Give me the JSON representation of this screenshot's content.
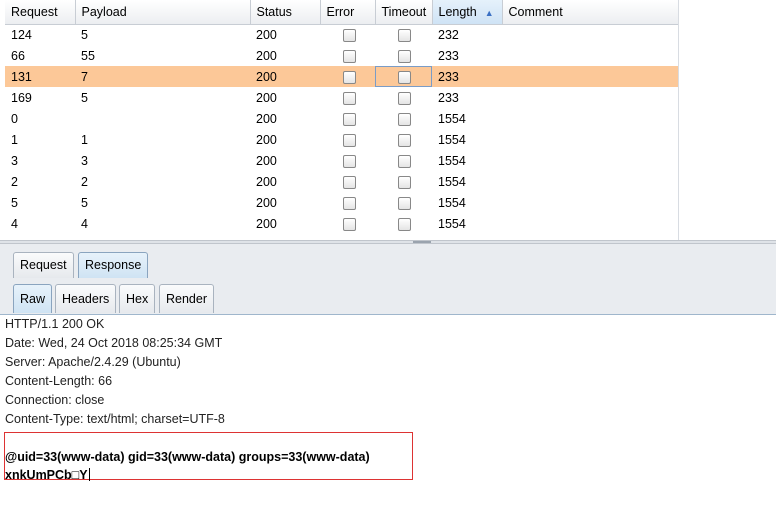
{
  "table": {
    "columns": [
      {
        "label": "Request"
      },
      {
        "label": "Payload"
      },
      {
        "label": "Status"
      },
      {
        "label": "Error"
      },
      {
        "label": "Timeout"
      },
      {
        "label": "Length"
      },
      {
        "label": "Comment"
      }
    ],
    "sorted_column": "Length",
    "sort_direction": "ascending",
    "rows": [
      {
        "request": "124",
        "payload": "5",
        "status": "200",
        "error": false,
        "timeout": false,
        "length": "232",
        "comment": "",
        "selected": false
      },
      {
        "request": "66",
        "payload": "55",
        "status": "200",
        "error": false,
        "timeout": false,
        "length": "233",
        "comment": "",
        "selected": false
      },
      {
        "request": "131",
        "payload": "7",
        "status": "200",
        "error": false,
        "timeout": false,
        "length": "233",
        "comment": "",
        "selected": true
      },
      {
        "request": "169",
        "payload": "5",
        "status": "200",
        "error": false,
        "timeout": false,
        "length": "233",
        "comment": "",
        "selected": false
      },
      {
        "request": "0",
        "payload": "",
        "status": "200",
        "error": false,
        "timeout": false,
        "length": "1554",
        "comment": "",
        "selected": false
      },
      {
        "request": "1",
        "payload": "1",
        "status": "200",
        "error": false,
        "timeout": false,
        "length": "1554",
        "comment": "",
        "selected": false
      },
      {
        "request": "3",
        "payload": "3",
        "status": "200",
        "error": false,
        "timeout": false,
        "length": "1554",
        "comment": "",
        "selected": false
      },
      {
        "request": "2",
        "payload": "2",
        "status": "200",
        "error": false,
        "timeout": false,
        "length": "1554",
        "comment": "",
        "selected": false
      },
      {
        "request": "5",
        "payload": "5",
        "status": "200",
        "error": false,
        "timeout": false,
        "length": "1554",
        "comment": "",
        "selected": false
      },
      {
        "request": "4",
        "payload": "4",
        "status": "200",
        "error": false,
        "timeout": false,
        "length": "1554",
        "comment": "",
        "selected": false
      }
    ]
  },
  "message_tabs": {
    "items": [
      {
        "label": "Request"
      },
      {
        "label": "Response"
      }
    ],
    "active": "Response"
  },
  "view_tabs": {
    "items": [
      {
        "label": "Raw"
      },
      {
        "label": "Headers"
      },
      {
        "label": "Hex"
      },
      {
        "label": "Render"
      }
    ],
    "active": "Raw"
  },
  "response": {
    "header_lines": [
      "HTTP/1.1 200 OK",
      "Date: Wed, 24 Oct 2018 08:25:34 GMT",
      "Server: Apache/2.4.29 (Ubuntu)",
      "Content-Length: 66",
      "Connection: close",
      "Content-Type: text/html; charset=UTF-8"
    ],
    "body_lines": [
      "@uid=33(www-data) gid=33(www-data) groups=33(www-data)",
      "xnkUmPCb□Y"
    ]
  },
  "colors": {
    "selected_row": "#fcc898",
    "highlight_border": "#dd3333",
    "active_tab": "#cfe3f3"
  },
  "icons": {
    "sort_indicator": "sort-ascending-icon"
  }
}
